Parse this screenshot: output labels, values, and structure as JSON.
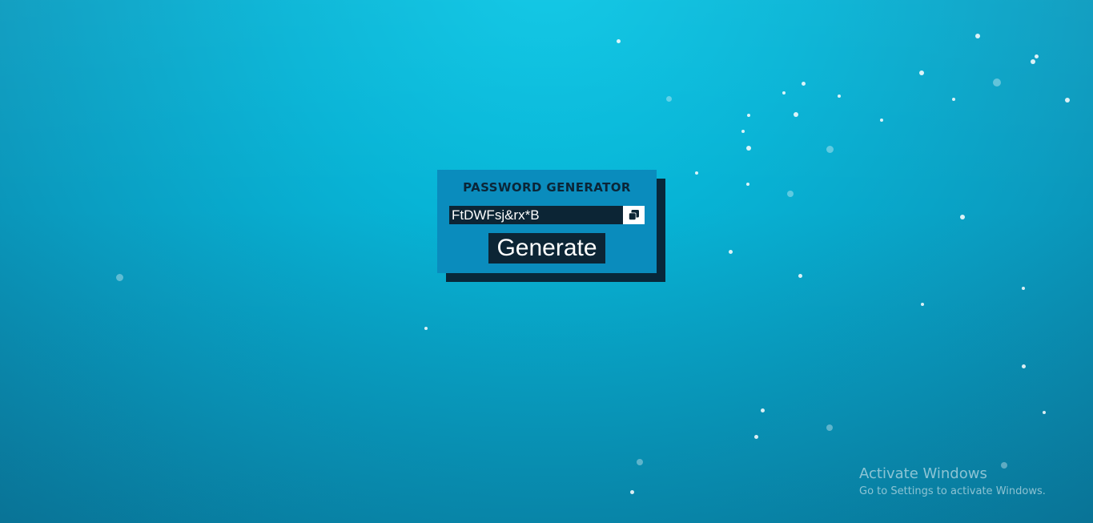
{
  "app": {
    "title": "PASSWORD GENERATOR"
  },
  "password": {
    "value": "FtDWFsj&rx*B"
  },
  "actions": {
    "copy_icon": "copy-icon",
    "generate_label": "Generate"
  },
  "watermark": {
    "title": "Activate Windows",
    "subtitle": "Go to Settings to activate Windows."
  },
  "colors": {
    "card": "#0a8cbd",
    "card_shadow": "#08283a",
    "dark": "#0c2535",
    "background": "#07b4d6"
  }
}
